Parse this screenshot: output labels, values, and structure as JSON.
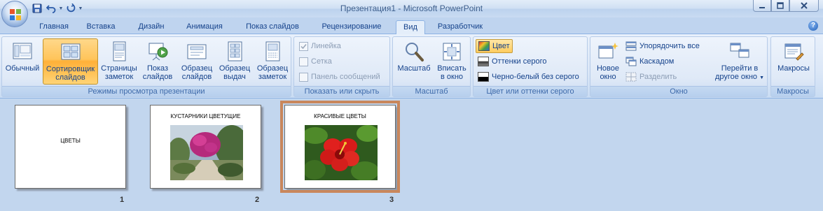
{
  "window": {
    "title": "Презентация1 - Microsoft PowerPoint"
  },
  "tabs": [
    {
      "label": "Главная"
    },
    {
      "label": "Вставка"
    },
    {
      "label": "Дизайн"
    },
    {
      "label": "Анимация"
    },
    {
      "label": "Показ слайдов"
    },
    {
      "label": "Рецензирование"
    },
    {
      "label": "Вид",
      "active": true
    },
    {
      "label": "Разработчик"
    }
  ],
  "ribbon": {
    "views": {
      "label": "Режимы просмотра презентации",
      "normal": "Обычный",
      "sorter_1": "Сортировщик",
      "sorter_2": "слайдов",
      "notes_1": "Страницы",
      "notes_2": "заметок",
      "show_1": "Показ",
      "show_2": "слайдов",
      "master_1": "Образец",
      "master_2": "слайдов",
      "handout_1": "Образец",
      "handout_2": "выдач",
      "notesmaster_1": "Образец",
      "notesmaster_2": "заметок"
    },
    "showhide": {
      "label": "Показать или скрыть",
      "ruler": "Линейка",
      "grid": "Сетка",
      "msgbar": "Панель сообщений"
    },
    "zoom": {
      "label": "Масштаб",
      "zoom": "Масштаб",
      "fit_1": "Вписать",
      "fit_2": "в окно"
    },
    "color": {
      "label": "Цвет или оттенки серого",
      "color": "Цвет",
      "grayscale": "Оттенки серого",
      "bw": "Черно-белый без серого"
    },
    "window": {
      "label": "Окно",
      "new_1": "Новое",
      "new_2": "окно",
      "arrange": "Упорядочить все",
      "cascade": "Каскадом",
      "split": "Разделить",
      "switch_1": "Перейти в",
      "switch_2": "другое окно"
    },
    "macros": {
      "label": "Макросы",
      "macros": "Макросы"
    }
  },
  "slides": [
    {
      "number": "1",
      "title": "ЦВЕТЫ"
    },
    {
      "number": "2",
      "title": "КУСТАРНИКИ ЦВЕТУЩИЕ"
    },
    {
      "number": "3",
      "title": "КРАСИВЫЕ ЦВЕТЫ"
    }
  ],
  "colors": {
    "accent_selected": "#ffc45a",
    "selected_slide_border": "#c9875c",
    "workspace": "#c2d6ee"
  }
}
